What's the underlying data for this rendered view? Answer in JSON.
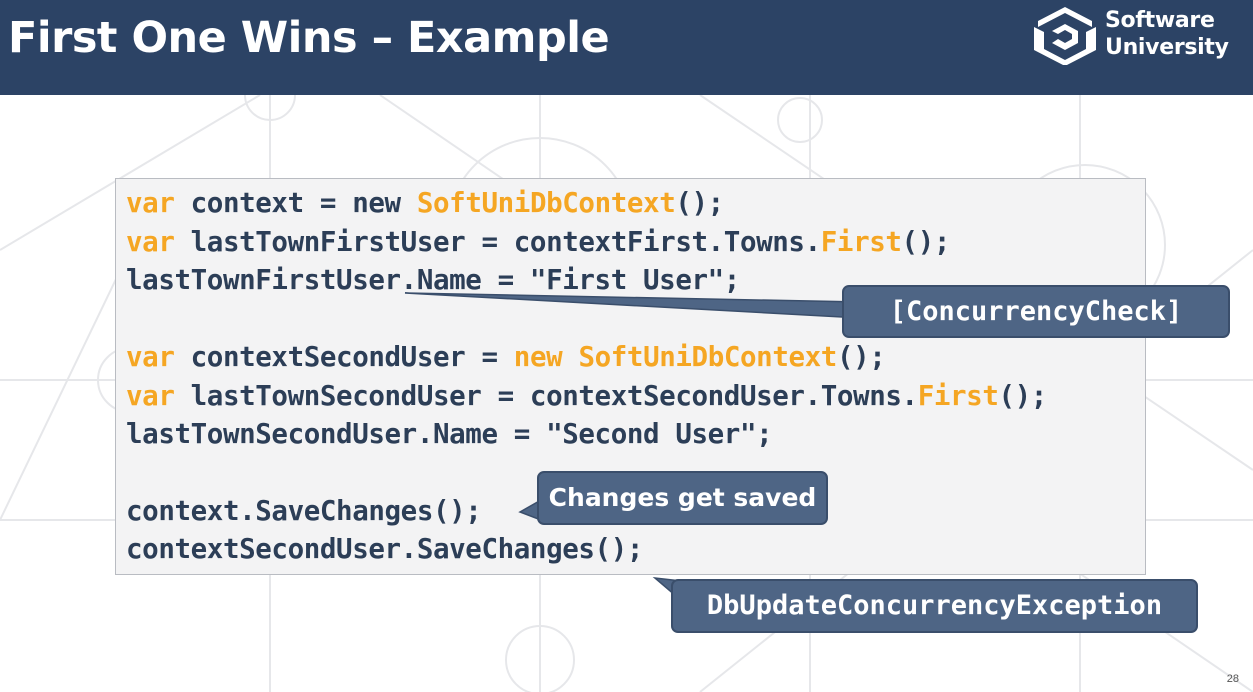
{
  "slide": {
    "title": "First One Wins – Example",
    "page_number": "28"
  },
  "logo": {
    "line1": "Software",
    "line2": "University"
  },
  "code": {
    "lines": [
      [
        {
          "t": "var",
          "k": true
        },
        {
          "t": " context = new "
        },
        {
          "t": "SoftUniDbContext",
          "k": true
        },
        {
          "t": "();"
        }
      ],
      [
        {
          "t": "var",
          "k": true
        },
        {
          "t": " lastTownFirstUser = contextFirst.Towns."
        },
        {
          "t": "First",
          "k": true
        },
        {
          "t": "();"
        }
      ],
      [
        {
          "t": "lastTownFirstUser.Name = \"First User\";"
        }
      ],
      [
        {
          "t": "var",
          "k": true
        },
        {
          "t": " contextSecondUser = "
        },
        {
          "t": "new",
          "k": true
        },
        {
          "t": " "
        },
        {
          "t": "SoftUniDbContext",
          "k": true
        },
        {
          "t": "();"
        }
      ],
      [
        {
          "t": "var",
          "k": true
        },
        {
          "t": " lastTownSecondUser = contextSecondUser.Towns."
        },
        {
          "t": "First",
          "k": true
        },
        {
          "t": "();"
        }
      ],
      [
        {
          "t": "lastTownSecondUser.Name = \"Second User\";"
        }
      ],
      [
        {
          "t": "context.SaveChanges();"
        }
      ],
      [
        {
          "t": "contextSecondUser.SaveChanges();"
        }
      ]
    ]
  },
  "callouts": {
    "concurrency_check": "[ConcurrencyCheck]",
    "changes_saved": "Changes get saved",
    "exception": "DbUpdateConcurrencyException"
  },
  "colors": {
    "header": "#2c4365",
    "keyword": "#f5a623",
    "code_text": "#2c3e57",
    "callout": "#4e6585"
  }
}
